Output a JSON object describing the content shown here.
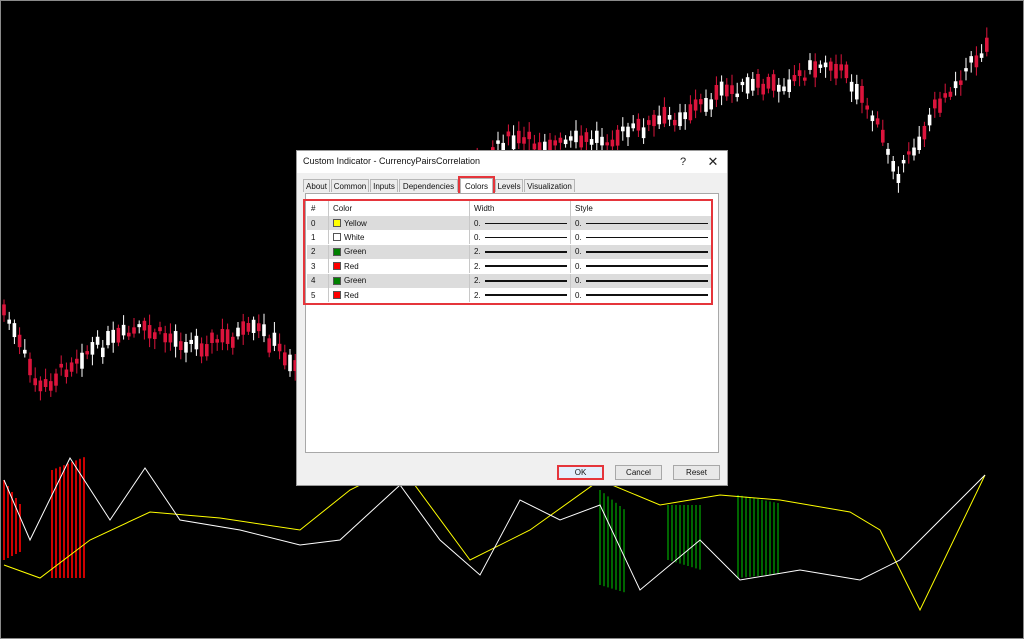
{
  "dialog": {
    "title": "Custom Indicator - CurrencyPairsCorrelation",
    "help_glyph": "?",
    "close_glyph": "✕",
    "tabs": [
      "About",
      "Common",
      "Inputs",
      "Dependencies",
      "Colors",
      "Levels",
      "Visualization"
    ],
    "active_tab": "Colors",
    "table": {
      "headers": [
        "#",
        "Color",
        "Width",
        "Style"
      ],
      "rows": [
        {
          "index": "0",
          "color_name": "Yellow",
          "color_hex": "#ffff00",
          "width_text": "0.",
          "style_text": "0.",
          "width_value": 0
        },
        {
          "index": "1",
          "color_name": "White",
          "color_hex": "#ffffff",
          "width_text": "0.",
          "style_text": "0.",
          "width_value": 0
        },
        {
          "index": "2",
          "color_name": "Green",
          "color_hex": "#008000",
          "width_text": "2.",
          "style_text": "0.",
          "width_value": 2
        },
        {
          "index": "3",
          "color_name": "Red",
          "color_hex": "#ff0000",
          "width_text": "2.",
          "style_text": "0.",
          "width_value": 2
        },
        {
          "index": "4",
          "color_name": "Green",
          "color_hex": "#008000",
          "width_text": "2.",
          "style_text": "0.",
          "width_value": 2
        },
        {
          "index": "5",
          "color_name": "Red",
          "color_hex": "#ff0000",
          "width_text": "2.",
          "style_text": "0.",
          "width_value": 2
        }
      ]
    },
    "buttons": {
      "ok": "OK",
      "cancel": "Cancel",
      "reset": "Reset"
    }
  },
  "colors": {
    "highlight": "#e5353b",
    "bull_candle": "#ffffff",
    "bear_candle": "#dc143c",
    "indicator_yellow": "#ffff00",
    "indicator_white": "#ffffff",
    "hist_green": "#008000",
    "hist_red": "#ff0000"
  }
}
